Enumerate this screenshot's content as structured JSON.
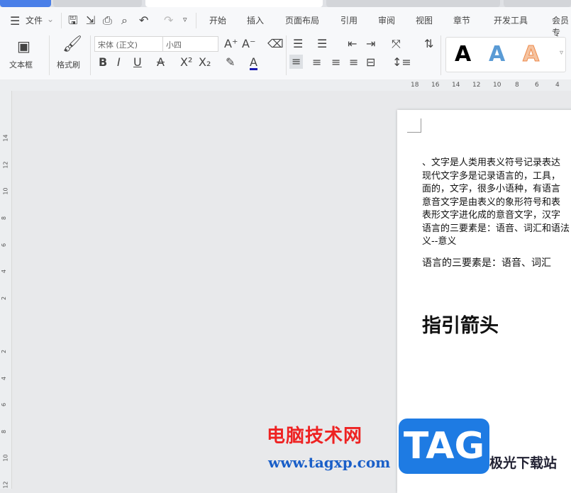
{
  "menu": {
    "file": "文件",
    "tabs": [
      "开始",
      "插入",
      "页面布局",
      "引用",
      "审阅",
      "视图",
      "章节",
      "开发工具",
      "会员专"
    ]
  },
  "toolbar": {
    "textbox": "文本框",
    "format_painter": "格式刷",
    "font": "宋体 (正文)",
    "size": "小四"
  },
  "styles": {
    "colors": [
      "#000000",
      "#5a9bd5",
      "#ed8a4b"
    ],
    "label": "A"
  },
  "ruler_h": [
    "18",
    "16",
    "14",
    "12",
    "10",
    "8",
    "6",
    "4"
  ],
  "ruler_v": [
    "14",
    "12",
    "10",
    "8",
    "6",
    "4",
    "2",
    "2",
    "4",
    "6",
    "8",
    "10",
    "12"
  ],
  "document": {
    "lines": [
      "、文字是人类用表义符号记录表达",
      "现代文字多是记录语言的，工具，",
      "面的，文字，很多小语种，有语言",
      "意音文字是由表义的象形符号和表",
      "表形文字进化成的意音文字，汉字",
      "语言的三要素是：语音、词汇和语法",
      "义--意义"
    ],
    "line2": "语言的三要素是：语音、词汇",
    "heading": "指引箭头"
  },
  "watermark": {
    "site_cn": "电脑技术网",
    "url": "www.tagxp.com",
    "logo": "TAG",
    "site2": "极光下载站"
  }
}
